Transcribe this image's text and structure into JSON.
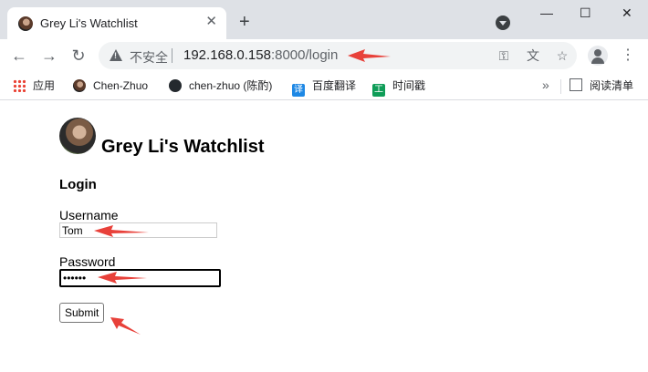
{
  "browser": {
    "tab_title": "Grey Li's Watchlist",
    "tab_close": "✕",
    "new_tab": "+",
    "window_controls": {
      "minimize": "—",
      "maximize": "☐",
      "close": "✕"
    },
    "security_label": "不安全",
    "url_host": "192.168.0.158",
    "url_port": ":8000",
    "url_path": "/login",
    "icons": [
      "back-icon",
      "forward-icon",
      "reload-icon",
      "warning-icon",
      "key-icon",
      "translate-icon",
      "star-icon",
      "profile-icon",
      "menu-icon"
    ]
  },
  "bookmarks": {
    "items": [
      {
        "label": "应用",
        "icon": "apps-icon"
      },
      {
        "label": "Chen-Zhuo",
        "icon": "avatar-icon"
      },
      {
        "label": "chen-zhuo (陈酌)",
        "icon": "github-icon"
      },
      {
        "label": "百度翻译",
        "icon": "translate-icon"
      },
      {
        "label": "时间戳",
        "icon": "clock-icon"
      }
    ],
    "more": "»",
    "reading_list": "阅读清单"
  },
  "page": {
    "title": "Grey Li's Watchlist",
    "heading": "Login",
    "username_label": "Username",
    "username_value": "Tom",
    "password_label": "Password",
    "password_value": "••••••",
    "submit_label": "Submit"
  },
  "colors": {
    "annotation_arrow": "#e8413a",
    "tab_strip": "#dee1e6",
    "omnibox": "#f1f3f4"
  }
}
